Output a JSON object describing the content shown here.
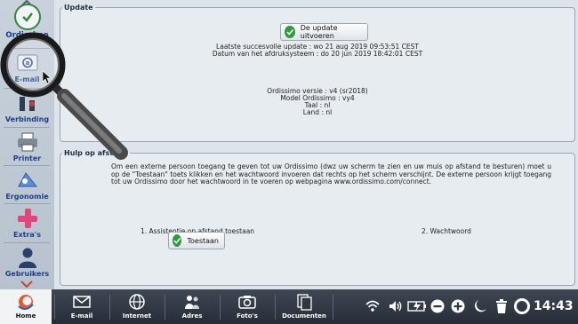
{
  "sidebar": {
    "items": [
      {
        "label": "Ordissimo",
        "icon": "check-icon"
      },
      {
        "label": "E-mail",
        "icon": "email-icon"
      },
      {
        "label": "Verbinding",
        "icon": "connection-icon"
      },
      {
        "label": "Printer",
        "icon": "printer-icon"
      },
      {
        "label": "Ergonomie",
        "icon": "ergonomics-icon"
      },
      {
        "label": "Extra's",
        "icon": "plus-icon"
      },
      {
        "label": "Gebruikers",
        "icon": "user-icon"
      }
    ]
  },
  "update": {
    "legend": "Update",
    "button_label": "De update uitvoeren",
    "last_update": "Laatste succesvolle update : wo 21 aug 2019 09:53:51 CEST",
    "system_date": "Datum van het afdruksysteem : do 20 jun 2019 18:42:01 CEST",
    "version": "Ordissimo versie : v4 (sr2018)",
    "model": "Model Ordissimo : vy4",
    "language": "Taal : nl",
    "country": "Land : nl"
  },
  "help": {
    "legend": "Hulp op afstand",
    "paragraph": "Om een externe persoon toegang te geven tot uw Ordissimo (dwz uw scherm te zien en uw muis op afstand te besturen) moet u op de \"Toestaan\" toets klikken en het wachtwoord invoeren dat rechts op het scherm verschijnt. De externe persoon krijgt toegang tot uw Ordissimo door het wachtwoord in te voeren op webpagina www.ordissimo.com/connect.",
    "step1": "1. Assistentie op afstand toestaan",
    "step2": "2. Wachtwoord",
    "allow_label": "Toestaan"
  },
  "taskbar": {
    "items": [
      {
        "label": "Home",
        "icon": "ordissimo-logo-icon"
      },
      {
        "label": "E-mail",
        "icon": "envelope-icon"
      },
      {
        "label": "Internet",
        "icon": "globe-icon"
      },
      {
        "label": "Adres",
        "icon": "contacts-icon"
      },
      {
        "label": "Foto's",
        "icon": "camera-icon"
      },
      {
        "label": "Documenten",
        "icon": "documents-icon"
      }
    ],
    "clock": "14:43"
  },
  "colors": {
    "accent_blue": "#1d3f8a",
    "confirm_green": "#2f9b3c",
    "taskbar": "#2f3742"
  }
}
